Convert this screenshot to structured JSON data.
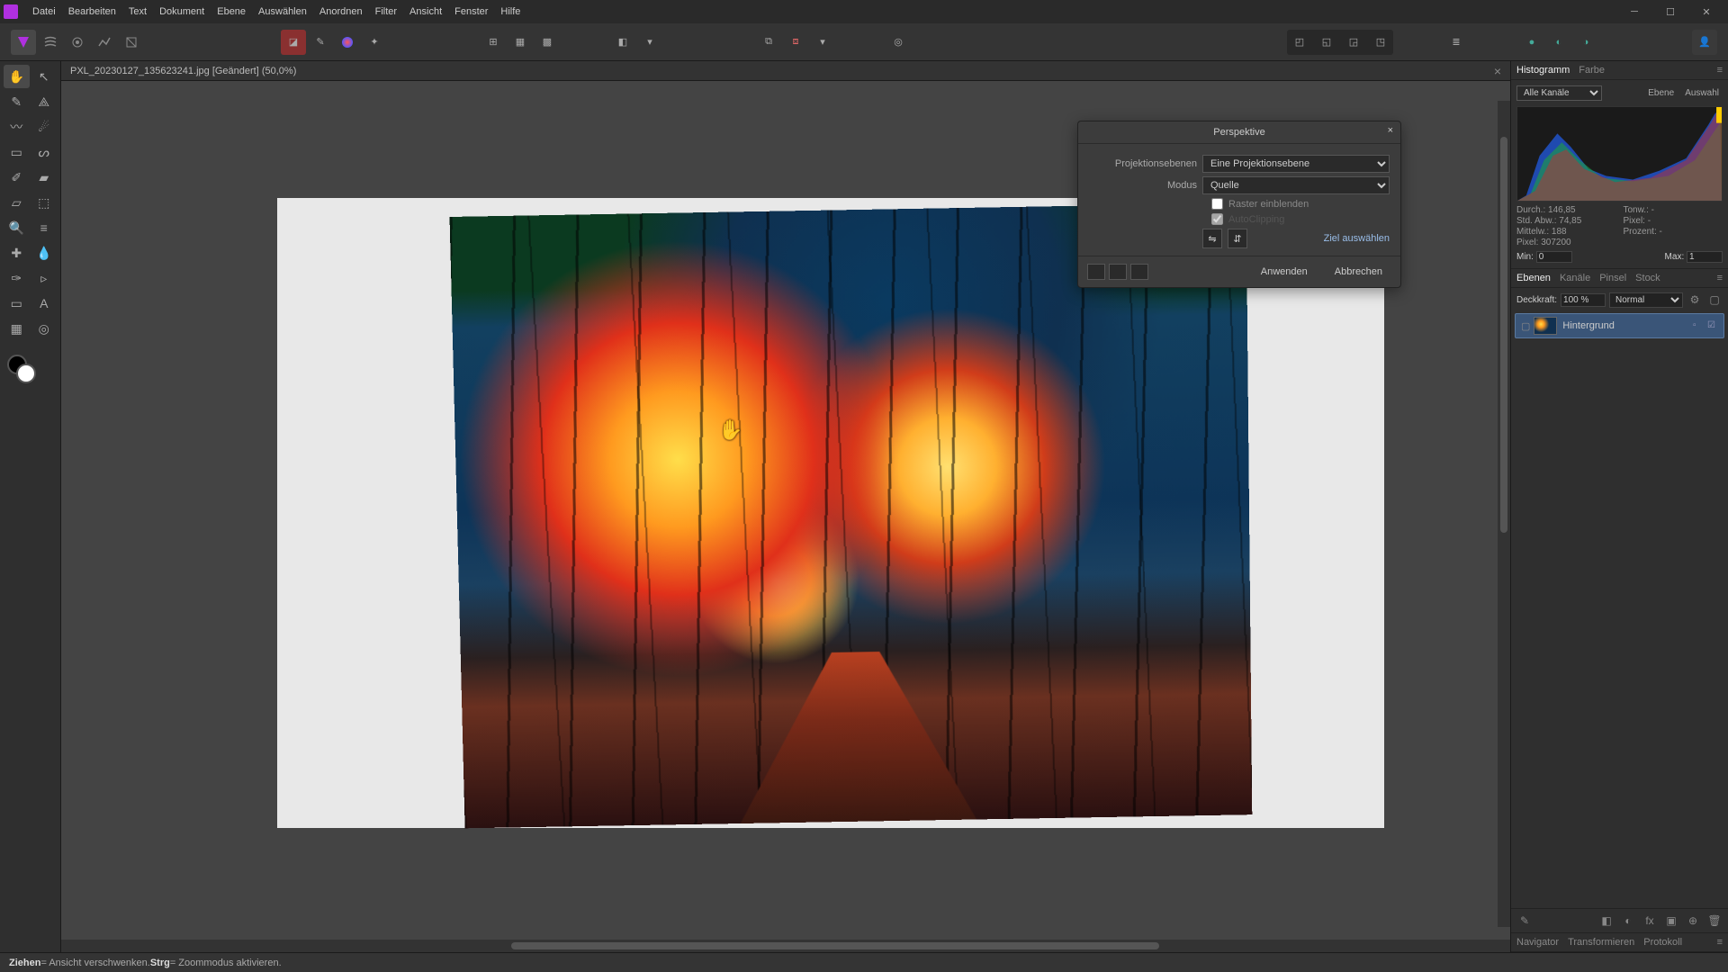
{
  "menu": [
    "Datei",
    "Bearbeiten",
    "Text",
    "Dokument",
    "Ebene",
    "Auswählen",
    "Anordnen",
    "Filter",
    "Ansicht",
    "Fenster",
    "Hilfe"
  ],
  "document_tab": "PXL_20230127_135623241.jpg [Geändert] (50,0%)",
  "statusbar": {
    "drag": "Ziehen",
    "drag_text": " = Ansicht verschwenken. ",
    "ctrl": "Strg",
    "ctrl_text": " = Zoommodus aktivieren."
  },
  "dialog": {
    "title": "Perspektive",
    "projection_label": "Projektionsebenen",
    "projection_value": "Eine Projektionsebene",
    "mode_label": "Modus",
    "mode_value": "Quelle",
    "opt_grid": "Raster einblenden",
    "opt_autoclip": "AutoClipping",
    "select_target": "Ziel auswählen",
    "apply": "Anwenden",
    "cancel": "Abbrechen"
  },
  "right": {
    "tabs_top": [
      "Histogramm",
      "Farbe"
    ],
    "channel": "Alle Kanäle",
    "btn_ebene": "Ebene",
    "btn_auswahl": "Auswahl",
    "stats": {
      "durch": "Durch.: 146,85",
      "stdabw": "Std. Abw.: 74,85",
      "mittelw": "Mittelw.: 188",
      "pixel": "Pixel: 307200",
      "tonw": "Tonw.: -",
      "pixel2": "Pixel: -",
      "prozent": "Prozent: -"
    },
    "min_label": "Min:",
    "min_value": "0",
    "max_label": "Max:",
    "max_value": "1",
    "tabs_mid": [
      "Ebenen",
      "Kanäle",
      "Pinsel",
      "Stock"
    ],
    "opacity_label": "Deckkraft:",
    "opacity_value": "100 %",
    "blend_value": "Normal",
    "layer_name": "Hintergrund",
    "tabs_bottom": [
      "Navigator",
      "Transformieren",
      "Protokoll"
    ]
  }
}
